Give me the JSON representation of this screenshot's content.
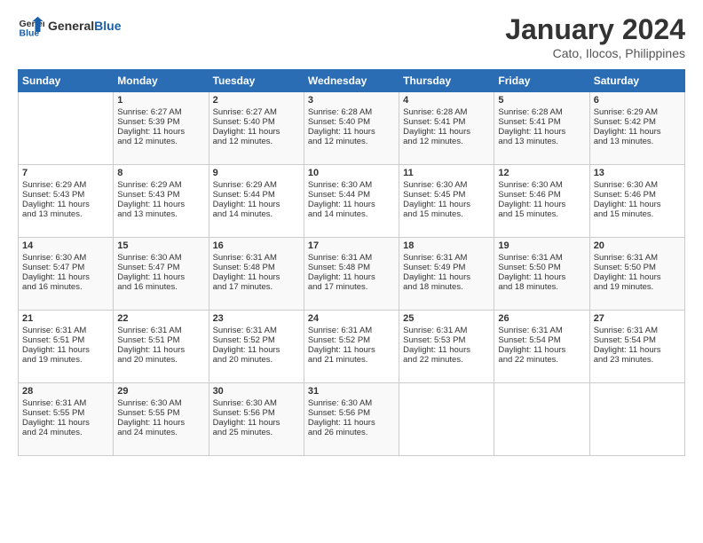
{
  "header": {
    "logo_text_general": "General",
    "logo_text_blue": "Blue",
    "month_title": "January 2024",
    "location": "Cato, Ilocos, Philippines"
  },
  "days_of_week": [
    "Sunday",
    "Monday",
    "Tuesday",
    "Wednesday",
    "Thursday",
    "Friday",
    "Saturday"
  ],
  "weeks": [
    [
      {
        "day": "",
        "info": ""
      },
      {
        "day": "1",
        "info": "Sunrise: 6:27 AM\nSunset: 5:39 PM\nDaylight: 11 hours\nand 12 minutes."
      },
      {
        "day": "2",
        "info": "Sunrise: 6:27 AM\nSunset: 5:40 PM\nDaylight: 11 hours\nand 12 minutes."
      },
      {
        "day": "3",
        "info": "Sunrise: 6:28 AM\nSunset: 5:40 PM\nDaylight: 11 hours\nand 12 minutes."
      },
      {
        "day": "4",
        "info": "Sunrise: 6:28 AM\nSunset: 5:41 PM\nDaylight: 11 hours\nand 12 minutes."
      },
      {
        "day": "5",
        "info": "Sunrise: 6:28 AM\nSunset: 5:41 PM\nDaylight: 11 hours\nand 13 minutes."
      },
      {
        "day": "6",
        "info": "Sunrise: 6:29 AM\nSunset: 5:42 PM\nDaylight: 11 hours\nand 13 minutes."
      }
    ],
    [
      {
        "day": "7",
        "info": "Sunrise: 6:29 AM\nSunset: 5:43 PM\nDaylight: 11 hours\nand 13 minutes."
      },
      {
        "day": "8",
        "info": "Sunrise: 6:29 AM\nSunset: 5:43 PM\nDaylight: 11 hours\nand 13 minutes."
      },
      {
        "day": "9",
        "info": "Sunrise: 6:29 AM\nSunset: 5:44 PM\nDaylight: 11 hours\nand 14 minutes."
      },
      {
        "day": "10",
        "info": "Sunrise: 6:30 AM\nSunset: 5:44 PM\nDaylight: 11 hours\nand 14 minutes."
      },
      {
        "day": "11",
        "info": "Sunrise: 6:30 AM\nSunset: 5:45 PM\nDaylight: 11 hours\nand 15 minutes."
      },
      {
        "day": "12",
        "info": "Sunrise: 6:30 AM\nSunset: 5:46 PM\nDaylight: 11 hours\nand 15 minutes."
      },
      {
        "day": "13",
        "info": "Sunrise: 6:30 AM\nSunset: 5:46 PM\nDaylight: 11 hours\nand 15 minutes."
      }
    ],
    [
      {
        "day": "14",
        "info": "Sunrise: 6:30 AM\nSunset: 5:47 PM\nDaylight: 11 hours\nand 16 minutes."
      },
      {
        "day": "15",
        "info": "Sunrise: 6:30 AM\nSunset: 5:47 PM\nDaylight: 11 hours\nand 16 minutes."
      },
      {
        "day": "16",
        "info": "Sunrise: 6:31 AM\nSunset: 5:48 PM\nDaylight: 11 hours\nand 17 minutes."
      },
      {
        "day": "17",
        "info": "Sunrise: 6:31 AM\nSunset: 5:48 PM\nDaylight: 11 hours\nand 17 minutes."
      },
      {
        "day": "18",
        "info": "Sunrise: 6:31 AM\nSunset: 5:49 PM\nDaylight: 11 hours\nand 18 minutes."
      },
      {
        "day": "19",
        "info": "Sunrise: 6:31 AM\nSunset: 5:50 PM\nDaylight: 11 hours\nand 18 minutes."
      },
      {
        "day": "20",
        "info": "Sunrise: 6:31 AM\nSunset: 5:50 PM\nDaylight: 11 hours\nand 19 minutes."
      }
    ],
    [
      {
        "day": "21",
        "info": "Sunrise: 6:31 AM\nSunset: 5:51 PM\nDaylight: 11 hours\nand 19 minutes."
      },
      {
        "day": "22",
        "info": "Sunrise: 6:31 AM\nSunset: 5:51 PM\nDaylight: 11 hours\nand 20 minutes."
      },
      {
        "day": "23",
        "info": "Sunrise: 6:31 AM\nSunset: 5:52 PM\nDaylight: 11 hours\nand 20 minutes."
      },
      {
        "day": "24",
        "info": "Sunrise: 6:31 AM\nSunset: 5:52 PM\nDaylight: 11 hours\nand 21 minutes."
      },
      {
        "day": "25",
        "info": "Sunrise: 6:31 AM\nSunset: 5:53 PM\nDaylight: 11 hours\nand 22 minutes."
      },
      {
        "day": "26",
        "info": "Sunrise: 6:31 AM\nSunset: 5:54 PM\nDaylight: 11 hours\nand 22 minutes."
      },
      {
        "day": "27",
        "info": "Sunrise: 6:31 AM\nSunset: 5:54 PM\nDaylight: 11 hours\nand 23 minutes."
      }
    ],
    [
      {
        "day": "28",
        "info": "Sunrise: 6:31 AM\nSunset: 5:55 PM\nDaylight: 11 hours\nand 24 minutes."
      },
      {
        "day": "29",
        "info": "Sunrise: 6:30 AM\nSunset: 5:55 PM\nDaylight: 11 hours\nand 24 minutes."
      },
      {
        "day": "30",
        "info": "Sunrise: 6:30 AM\nSunset: 5:56 PM\nDaylight: 11 hours\nand 25 minutes."
      },
      {
        "day": "31",
        "info": "Sunrise: 6:30 AM\nSunset: 5:56 PM\nDaylight: 11 hours\nand 26 minutes."
      },
      {
        "day": "",
        "info": ""
      },
      {
        "day": "",
        "info": ""
      },
      {
        "day": "",
        "info": ""
      }
    ]
  ]
}
